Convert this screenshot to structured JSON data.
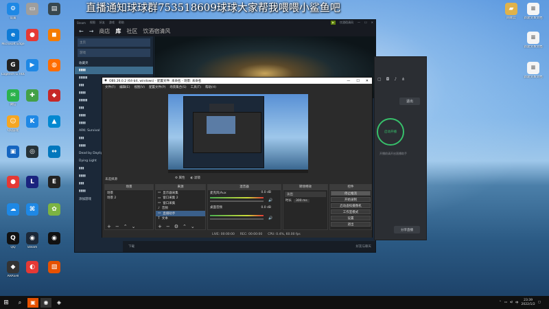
{
  "banner": {
    "text": "直播通知球球群753518609球球大家帮我喂喂小鲨鱼吧"
  },
  "desktop": {
    "icons_col1": [
      "设置",
      "Microsoft Edge",
      "Logitech G HUB",
      "微信",
      "QQ游戏",
      "",
      "",
      "",
      "",
      "",
      "QQ",
      "ARASHI"
    ],
    "icons_col2": [
      "",
      "",
      "",
      "",
      "",
      "",
      "",
      "",
      "",
      "",
      "Steam",
      ""
    ],
    "icons_col3": [
      "",
      "",
      "",
      "",
      "",
      "",
      "",
      "",
      "",
      "",
      "",
      ""
    ],
    "right_icons": [
      "网易云",
      "新建文本文档",
      "新建文本文档",
      "新建文本文档"
    ]
  },
  "steam": {
    "titlebar": {
      "menus": [
        "Steam",
        "视图",
        "好友",
        "游戏",
        "帮助"
      ],
      "badge": "",
      "user": "饮酒宿清风"
    },
    "nav": {
      "back": "←",
      "forward": "→",
      "store": "商店",
      "library": "库",
      "community": "社区",
      "user": "饮酒宿清风"
    },
    "sidebar": {
      "home": "主页",
      "games": "游戏",
      "items": [
        "收藏夹",
        "",
        "",
        "",
        "",
        "",
        "",
        "",
        "",
        "ARK: Survival",
        "",
        "",
        "Dead by Daylight",
        "Dying Light",
        "",
        "",
        "",
        "",
        "添加游戏"
      ]
    },
    "bottom": {
      "downloads": "下载",
      "friends": "好友与聊天"
    }
  },
  "netease": {
    "exit": "退出",
    "start": "启动开播",
    "note": "开播前请开启直播助手",
    "share": "分享直播"
  },
  "obs": {
    "title": "OBS 26.0.2 (64-bit, windows) - 配置文件: 未命名 - 场景: 未命名",
    "menu": [
      "文件(F)",
      "编辑(E)",
      "视图(V)",
      "配置文件(P)",
      "场景集合(S)",
      "工具(T)",
      "帮助(H)"
    ],
    "no_source": "未选择源",
    "props": "属性",
    "filters": "滤镜",
    "scenes": {
      "header": "场景",
      "items": [
        "场景",
        "场景 2"
      ]
    },
    "sources": {
      "header": "来源",
      "items": [
        "显示器采集",
        "窗口采集 2",
        "窗口采集",
        "音频",
        "直播助手",
        "文本"
      ]
    },
    "mixer": {
      "header": "混音器",
      "ch1": "麦克风/Aux",
      "ch2": "桌面音频",
      "db1": "0.0 dB",
      "db2": "0.0 dB"
    },
    "transitions": {
      "header": "转场特效",
      "type": "淡出",
      "duration_label": "时长",
      "duration": "300 ms"
    },
    "controls": {
      "header": "控件",
      "buttons": [
        "停止推流",
        "开始录制",
        "启动虚拟摄像机",
        "工作室模式",
        "设置",
        "退出"
      ]
    },
    "status": {
      "live": "LIVE: 00:00:00",
      "rec": "REC: 00:00:00",
      "cpu": "CPU: 0.4%, 60.00 fps"
    }
  },
  "taskbar": {
    "time": "23:39",
    "date": "2022/1/2",
    "lang": "中"
  }
}
